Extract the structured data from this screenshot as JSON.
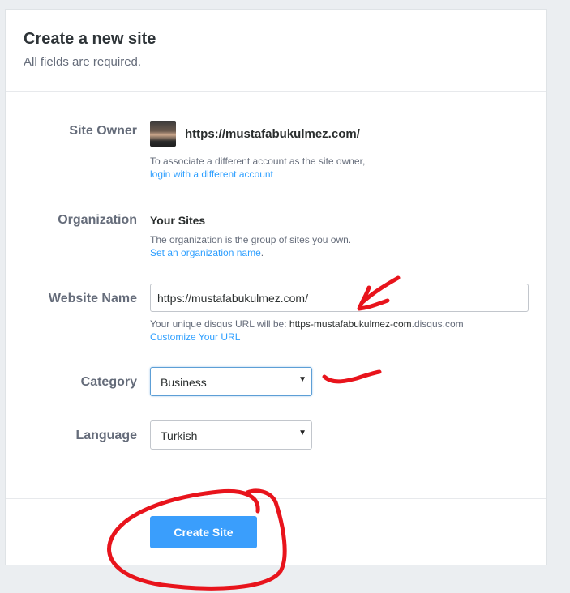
{
  "header": {
    "title": "Create a new site",
    "subtitle": "All fields are required."
  },
  "owner": {
    "label": "Site Owner",
    "url": "https://mustafabukulmez.com/",
    "help_text": "To associate a different account as the site owner,",
    "help_link": "login with a different account"
  },
  "organization": {
    "label": "Organization",
    "name": "Your Sites",
    "help_text": "The organization is the group of sites you own.",
    "help_link": "Set an organization name",
    "help_suffix": "."
  },
  "website": {
    "label": "Website Name",
    "value": "https://mustafabukulmez.com/",
    "help_prefix": "Your unique disqus URL will be:",
    "url_slug": "https-mustafabukulmez-com",
    "url_domain": ".disqus.com",
    "customize_link": "Customize Your URL"
  },
  "category": {
    "label": "Category",
    "selected": "Business"
  },
  "language": {
    "label": "Language",
    "selected": "Turkish"
  },
  "actions": {
    "create_label": "Create Site"
  },
  "colors": {
    "accent": "#3a9efc",
    "link": "#2e9fff",
    "annotation": "#e8141c"
  }
}
